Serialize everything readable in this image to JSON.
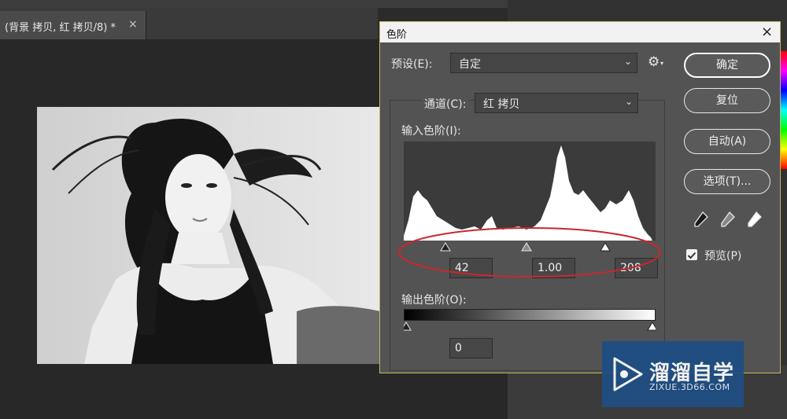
{
  "document_tab": {
    "title": "(背景 拷贝, 红 拷贝/8) *",
    "close": "×"
  },
  "dialog": {
    "title": "色阶",
    "close": "×",
    "preset": {
      "label": "预设(E):",
      "value": "自定"
    },
    "channel": {
      "label": "通道(C):",
      "value": "红 拷贝"
    },
    "input_levels": {
      "label": "输入色阶(I):",
      "black": "42",
      "gamma": "1.00",
      "white": "208"
    },
    "output_levels": {
      "label": "输出色阶(O):",
      "black": "0"
    },
    "buttons": {
      "ok": "确定",
      "reset": "复位",
      "auto": "自动(A)",
      "options": "选项(T)..."
    },
    "preview": {
      "label": "预览(P)",
      "checked": true
    }
  },
  "watermark": {
    "name": "溜溜自学",
    "url": "ZIXUE.3D66.COM"
  },
  "colors": {
    "annotation": "#c8282d",
    "dialog_bg": "#535353",
    "watermark_bg": "#1e4e84"
  }
}
